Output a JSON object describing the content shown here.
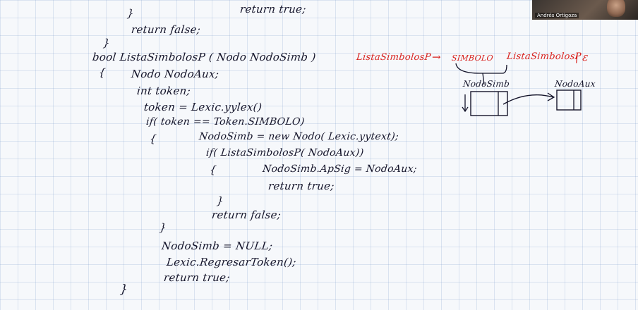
{
  "webcam": {
    "participant_name": "Andrés Ortigoza"
  },
  "code": {
    "line01": "return true;",
    "line02": "}",
    "line03": "return false;",
    "line04": "}",
    "line05": "bool ListaSimbolosP ( Nodo NodoSimb )",
    "line06": "{",
    "line07": "Nodo NodoAux;",
    "line08": "int token;",
    "line09": "token = Lexic.yylex()",
    "line10": "if( token == Token.SIMBOLO)",
    "line11": "{",
    "line12": "NodoSimb = new Nodo( Lexic.yytext);",
    "line13": "if( ListaSimbolosP( NodoAux))",
    "line14": "{",
    "line15": "NodoSimb.ApSig = NodoAux;",
    "line16": "return true;",
    "line17": "}",
    "line18": "return false;",
    "line19": "}",
    "line20": "NodoSimb = NULL;",
    "line21": "Lexic.RegresarToken();",
    "line22": "return true;",
    "line23": "}"
  },
  "grammar": {
    "lhs": "ListaSimbolosP",
    "arrow": "→",
    "rhs_terminal": "SIMBOLO",
    "rhs_nonterminal": "ListaSimbolosP",
    "alt": "| ε"
  },
  "diagram": {
    "left_label": "NodoSimb",
    "right_label": "NodoAux"
  }
}
